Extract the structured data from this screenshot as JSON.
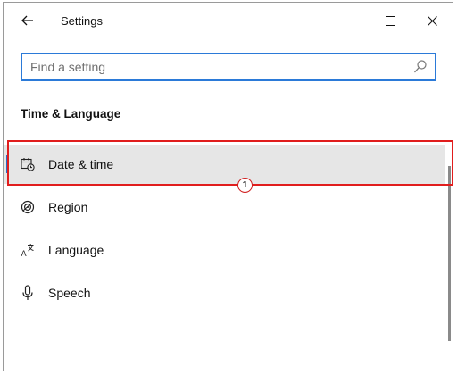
{
  "window": {
    "title": "Settings",
    "back_icon": "arrow-left-icon",
    "controls": {
      "minimize_icon": "minimize-icon",
      "maximize_icon": "maximize-icon",
      "close_icon": "close-icon"
    }
  },
  "search": {
    "placeholder": "Find a setting",
    "value": "",
    "icon": "search-icon"
  },
  "section": {
    "title": "Time & Language"
  },
  "nav": {
    "items": [
      {
        "label": "Date & time",
        "icon": "calendar-clock-icon",
        "selected": true
      },
      {
        "label": "Region",
        "icon": "globe-icon",
        "selected": false
      },
      {
        "label": "Language",
        "icon": "language-icon",
        "selected": false
      },
      {
        "label": "Speech",
        "icon": "microphone-icon",
        "selected": false
      }
    ]
  },
  "annotation": {
    "marker": "1",
    "color": "#e11d1d"
  },
  "colors": {
    "accent": "#2b6cc4",
    "search_border": "#2b7ad8",
    "selected_bg": "#e6e6e6"
  }
}
